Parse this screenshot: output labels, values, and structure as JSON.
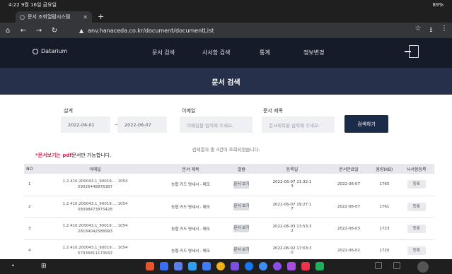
{
  "status_bar": {
    "time": "4:22 9월 16일 금요일",
    "battery": "89%"
  },
  "browser": {
    "tab_title": "문서 조회열람시스템",
    "url": "anv.hanaceda.co.kr/document/documentList"
  },
  "site": {
    "logo": "Datarium",
    "menu": [
      "문서 검색",
      "사서함 검색",
      "통계",
      "정보변경"
    ]
  },
  "page_title": "문서 검색",
  "search": {
    "period_label": "설계",
    "date_from": "2022-06-01",
    "date_to": "2022-06-07",
    "email_label": "이메일",
    "email_placeholder": "이메일를 입력해 주세요.",
    "title_label": "문서 제목",
    "title_placeholder": "문서제목을 입력해 주세요.",
    "button": "검색하기"
  },
  "notice": {
    "prefix": "*문서보기는 ",
    "highlight": "pdf",
    "suffix": "문서만 가능합니다."
  },
  "result_info": "검색결과 총 4건이 조회되었습니다.",
  "table": {
    "headers": [
      "NO",
      "이메일",
      "문서 제목",
      "열람",
      "등록일",
      "문서만료일",
      "용량(KB)",
      "사서함등록"
    ],
    "rows": [
      {
        "no": "1",
        "id_line1": "1.2.410.200043.1_90019.... 1054",
        "id_line2": "59026448876387",
        "title": "농협 카드 명세서 - 메모",
        "view": "문서 보기",
        "date_line1": "2022-06-07 21:32:1",
        "date_line2": "3",
        "expire": "2022-06-07",
        "size": "1765",
        "reg": "등록"
      },
      {
        "no": "2",
        "id_line1": "1.2.410.200043.1_90019.... 1054",
        "id_line2": "58098473875428",
        "title": "농협 카드 명세서 - 메모",
        "view": "문서 보기",
        "date_line1": "2022-06-07 19:27:1",
        "date_line2": "7",
        "expire": "2022-06-07",
        "size": "1761",
        "reg": "등록"
      },
      {
        "no": "3",
        "id_line1": "1.2.410.200043.1_90019.... 1054",
        "id_line2": "28184042588993",
        "title": "농협 카드 명세서 - 메모",
        "view": "문서 보기",
        "date_line1": "2022-06-03 13:53:3",
        "date_line2": "2",
        "expire": "2022-06-03",
        "size": "1723",
        "reg": "등록"
      },
      {
        "no": "4",
        "id_line1": "1.2.410.200043.1_90019.... 1054",
        "id_line2": "57936811173932",
        "title": "농협 카드 명세서 - 메모",
        "view": "문서 보기",
        "date_line1": "2022-06-02 17:03:3",
        "date_line2": "0",
        "expire": "2022-06-02",
        "size": "1720",
        "reg": "등록"
      }
    ]
  },
  "colors": {
    "header_bg": "#151b29",
    "band_bg": "#26304a",
    "button_bg": "#1b2b4a",
    "notice_accent": "#e0234d"
  }
}
